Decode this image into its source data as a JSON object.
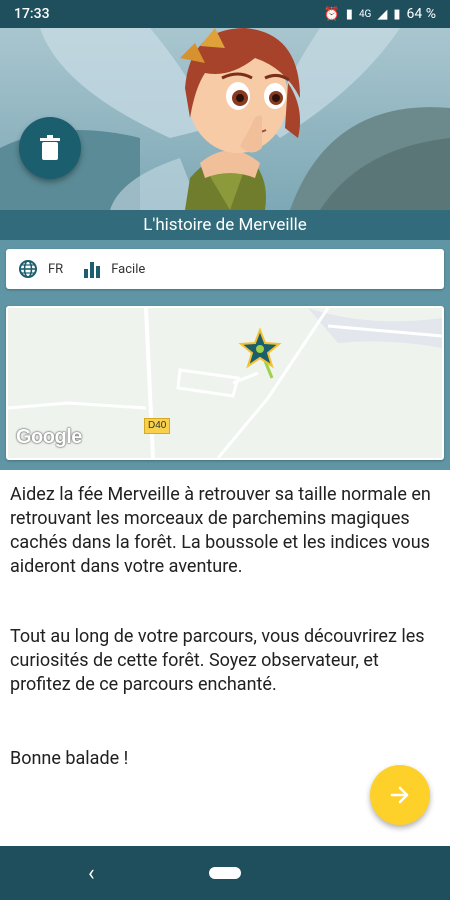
{
  "status_bar": {
    "time": "17:33",
    "network": "4G",
    "battery": "64 %"
  },
  "header": {
    "title": "L'histoire de Merveille"
  },
  "info": {
    "language": "FR",
    "difficulty": "Facile"
  },
  "map": {
    "road_label": "D40",
    "logo_text": "Google"
  },
  "description": {
    "paragraphs": [
      "Aidez la fée Merveille à retrouver sa taille normale en retrouvant les morceaux de parchemins magiques cachés dans la forêt. La boussole et les indices vous aideront dans votre aventure.",
      "Tout au long de votre parcours, vous découvrirez les curiosités de cette forêt. Soyez observateur, et profitez de ce parcours enchanté.",
      "Bonne balade !"
    ]
  },
  "colors": {
    "primary": "#326c7c",
    "accent": "#fdd12a",
    "dark": "#1f4f5c"
  },
  "icons": {
    "delete": "trash-icon",
    "language": "globe-icon",
    "difficulty": "bar-chart-icon",
    "next": "arrow-right-icon",
    "marker": "star-wand-icon"
  }
}
